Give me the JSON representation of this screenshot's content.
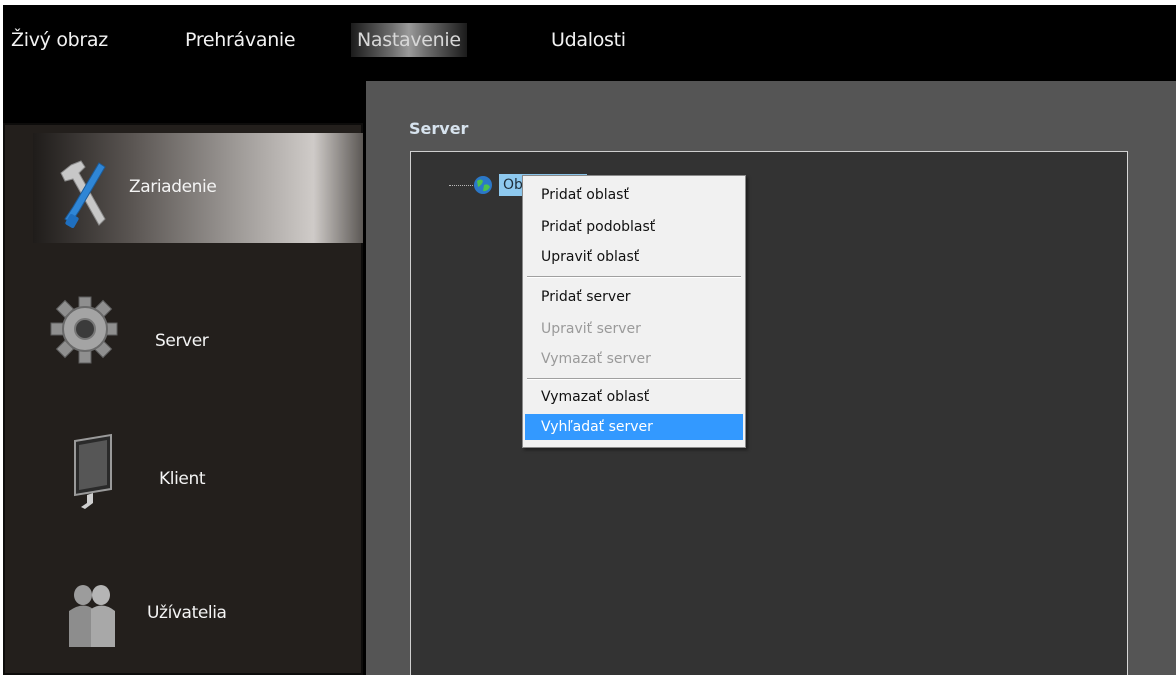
{
  "topnav": {
    "tabs": [
      {
        "label": "Živý obraz"
      },
      {
        "label": "Prehrávanie"
      },
      {
        "label": "Nastavenie"
      },
      {
        "label": "Udalosti"
      }
    ],
    "active": "Nastavenie"
  },
  "sidebar": {
    "items": [
      {
        "label": "Zariadenie",
        "icon": "wrench-screwdriver-icon"
      },
      {
        "label": "Server",
        "icon": "gear-icon"
      },
      {
        "label": "Klient",
        "icon": "monitor-icon"
      },
      {
        "label": "Užívatelia",
        "icon": "users-icon"
      }
    ]
  },
  "main": {
    "title": "Server",
    "tree": {
      "root_label": "Oblasť",
      "root_icon": "globe-icon"
    }
  },
  "context_menu": {
    "items": [
      {
        "label": "Pridať oblasť",
        "enabled": true
      },
      {
        "label": "Pridať podoblasť",
        "enabled": true
      },
      {
        "label": "Upraviť oblasť",
        "enabled": true
      },
      {
        "label": "Pridať server",
        "enabled": true
      },
      {
        "label": "Upraviť server",
        "enabled": false
      },
      {
        "label": "Vymazať server",
        "enabled": false
      },
      {
        "label": "Vymazať oblasť",
        "enabled": true
      },
      {
        "label": "Vyhľadať server",
        "enabled": true,
        "highlighted": true
      }
    ]
  },
  "colors": {
    "accent": "#3399ff",
    "selection": "#8ec9ef",
    "panel": "#555555",
    "sidebar": "#231f1c"
  }
}
